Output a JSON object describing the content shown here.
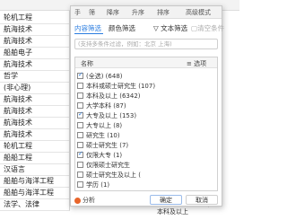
{
  "sheet": {
    "rows": [
      "轮机工程",
      "航海技术",
      "航海技术",
      "船舶电子",
      "航海技术",
      "哲学",
      "(非心理)",
      "航海技术",
      "航海技术",
      "航海技术",
      "航海技术",
      "轮机工程",
      "船船工程",
      "汉语言",
      "船舶与海洋工程",
      "船舶与海洋工程",
      "法学、法律"
    ],
    "bottom_right": "本科及以上",
    "right_col": [
      "本",
      "本",
      "(",
      "本",
      "本"
    ]
  },
  "dialog": {
    "top_tabs": [
      "手",
      "筛",
      "降序",
      "升序",
      "排序",
      "高级模式"
    ],
    "tabs": {
      "content": "内容筛选",
      "color": "颜色筛选",
      "text": "文本筛选",
      "clear": "清空条件"
    },
    "search": {
      "placeholder": "(支持多条件过滤，例如：北京 上海)"
    },
    "list": {
      "col_name": "名称",
      "col_options": "选项",
      "items": [
        {
          "label": "(全选) (648)",
          "checked": true
        },
        {
          "label": "本科或硕士研究生 (107)",
          "checked": false
        },
        {
          "label": "本科及以上 (6342)",
          "checked": false
        },
        {
          "label": "大学本科 (87)",
          "checked": false
        },
        {
          "label": "大专及以上 (153)",
          "checked": true
        },
        {
          "label": "大专以上 (8)",
          "checked": false
        },
        {
          "label": "研究生 (10)",
          "checked": false
        },
        {
          "label": "硕士研究生 (7)",
          "checked": false
        },
        {
          "label": "仅限大专 (1)",
          "checked": true
        },
        {
          "label": "仅限硕士研究生",
          "checked": false
        },
        {
          "label": "硕士研究生及以上 (",
          "checked": false
        },
        {
          "label": "学历 (1)",
          "checked": false
        }
      ]
    },
    "footer": {
      "analyze": "分析",
      "ok": "确定",
      "cancel": "取消"
    }
  },
  "colors": {
    "accent": "#2b7de0",
    "analyze_dot": "#e8652b"
  }
}
